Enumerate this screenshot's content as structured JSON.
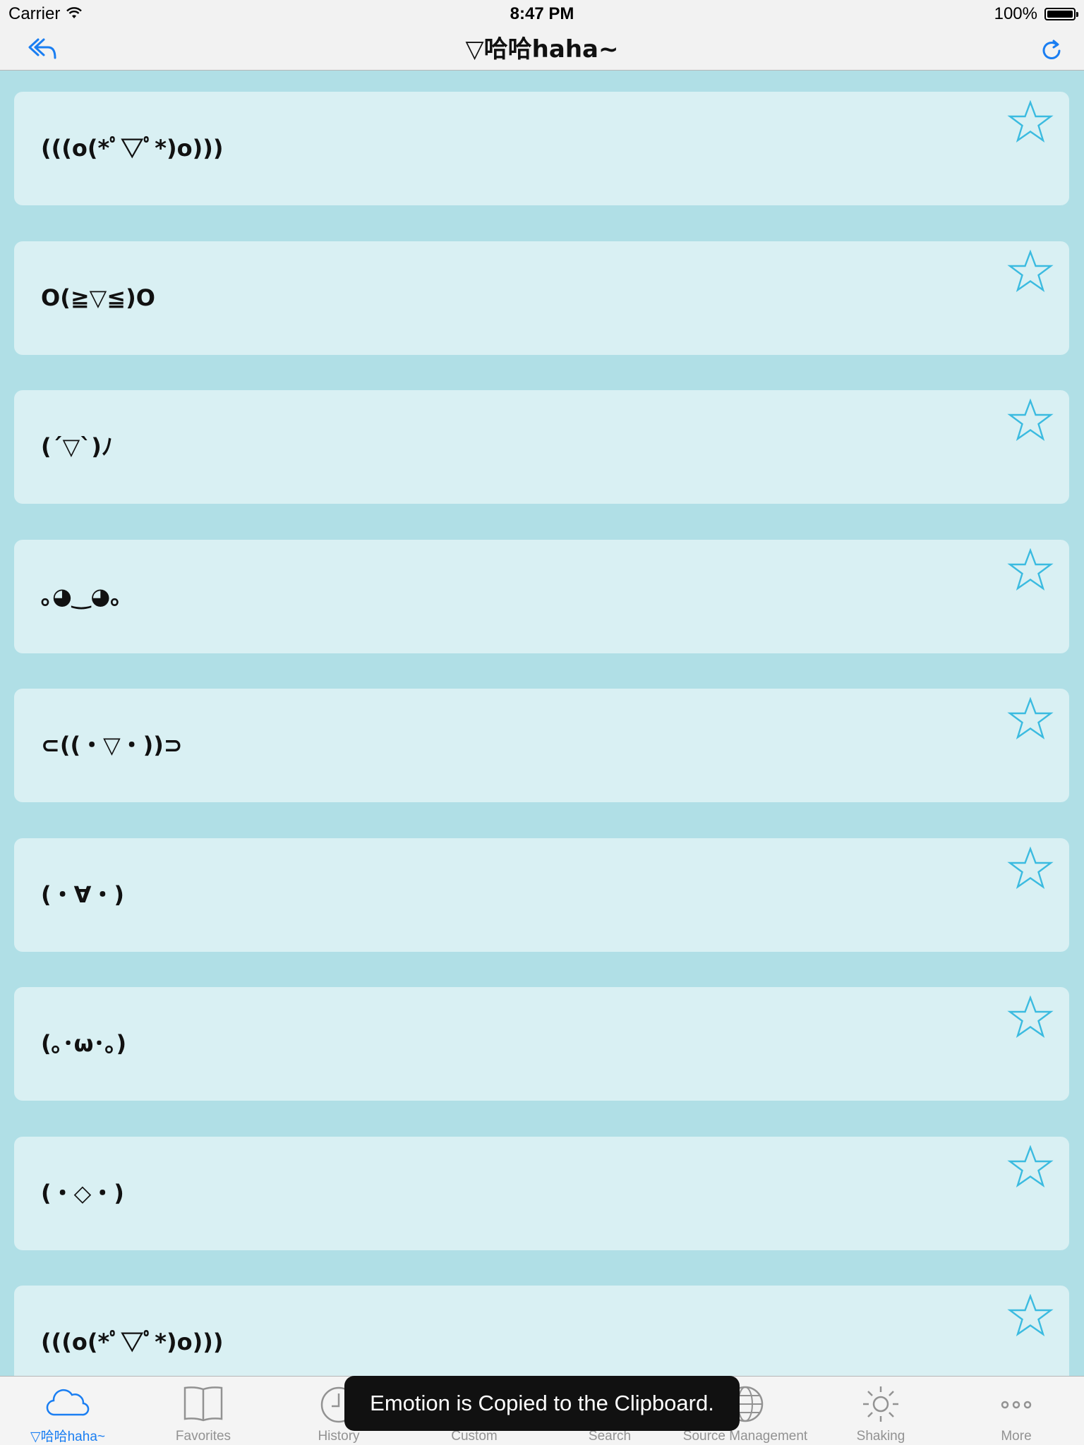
{
  "status_bar": {
    "carrier": "Carrier",
    "time": "8:47 PM",
    "battery": "100%"
  },
  "nav": {
    "title": "▽哈哈haha~"
  },
  "colors": {
    "accent": "#1a7ef2",
    "star": "#3bbbe0",
    "background": "#b0dfe6",
    "card": "#d9f0f3"
  },
  "emoticons": [
    "(((o(*ﾟ▽ﾟ*)o)))",
    "O(≧▽≦)O",
    "(´▽`)ﾉ",
    "｡◕‿◕｡",
    "⊂((・▽・))⊃",
    "(・∀・)",
    "(｡･ω･｡)",
    "(・◇・)",
    "(((o(*ﾟ▽ﾟ*)o)))"
  ],
  "tabs": [
    {
      "label": "▽哈哈haha~",
      "icon": "cloud-icon",
      "active": true
    },
    {
      "label": "Favorites",
      "icon": "book-icon",
      "active": false
    },
    {
      "label": "History",
      "icon": "clock-icon",
      "active": false
    },
    {
      "label": "Custom",
      "icon": "edit-icon",
      "active": false
    },
    {
      "label": "Search",
      "icon": "search-icon",
      "active": false
    },
    {
      "label": "Source Management",
      "icon": "globe-icon",
      "active": false
    },
    {
      "label": "Shaking",
      "icon": "sun-icon",
      "active": false
    },
    {
      "label": "More",
      "icon": "more-icon",
      "active": false
    }
  ],
  "toast": {
    "message": "Emotion is Copied to the Clipboard."
  }
}
